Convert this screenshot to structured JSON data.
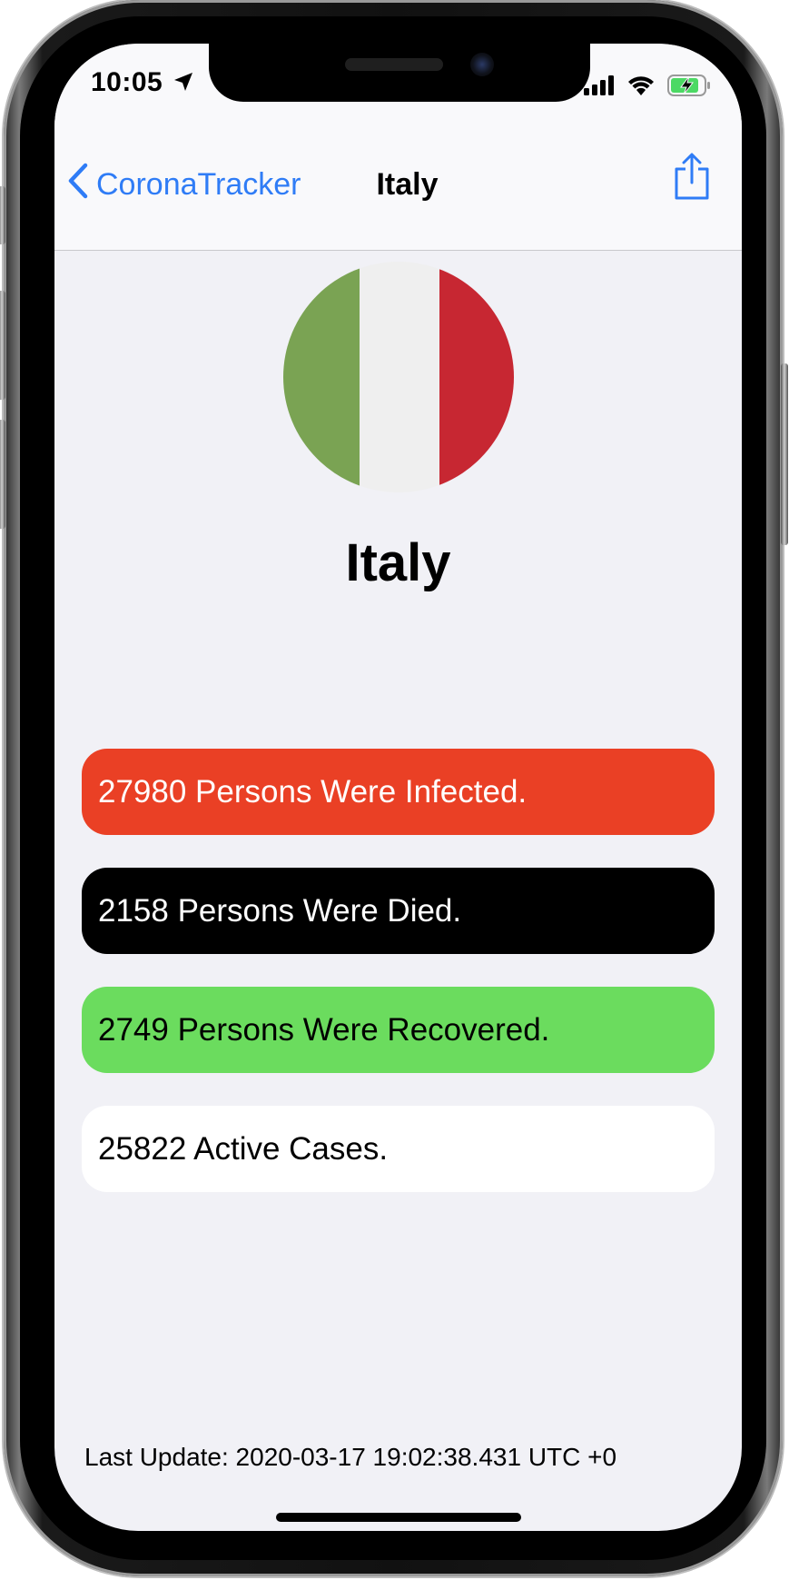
{
  "status_bar": {
    "time": "10:05",
    "icons": [
      "location-arrow-icon",
      "cellular-signal-icon",
      "wifi-icon",
      "battery-charging-icon"
    ]
  },
  "nav": {
    "back_label": "CoronaTracker",
    "title": "Italy",
    "share_icon": "share-icon"
  },
  "country": {
    "name": "Italy",
    "flag_colors": [
      "#7aa353",
      "#efefef",
      "#c72732"
    ]
  },
  "stats": {
    "infected": "27980 Persons Were Infected.",
    "died": "2158 Persons Were Died.",
    "recovered": "2749 Persons Were Recovered.",
    "active": "25822 Active Cases."
  },
  "colors": {
    "accent": "#2f7cf6",
    "infected": "#ea4025",
    "died": "#000000",
    "recovered": "#6bdc5e",
    "active": "#ffffff"
  },
  "footer": {
    "last_update": "Last Update: 2020-03-17 19:02:38.431 UTC +0"
  }
}
